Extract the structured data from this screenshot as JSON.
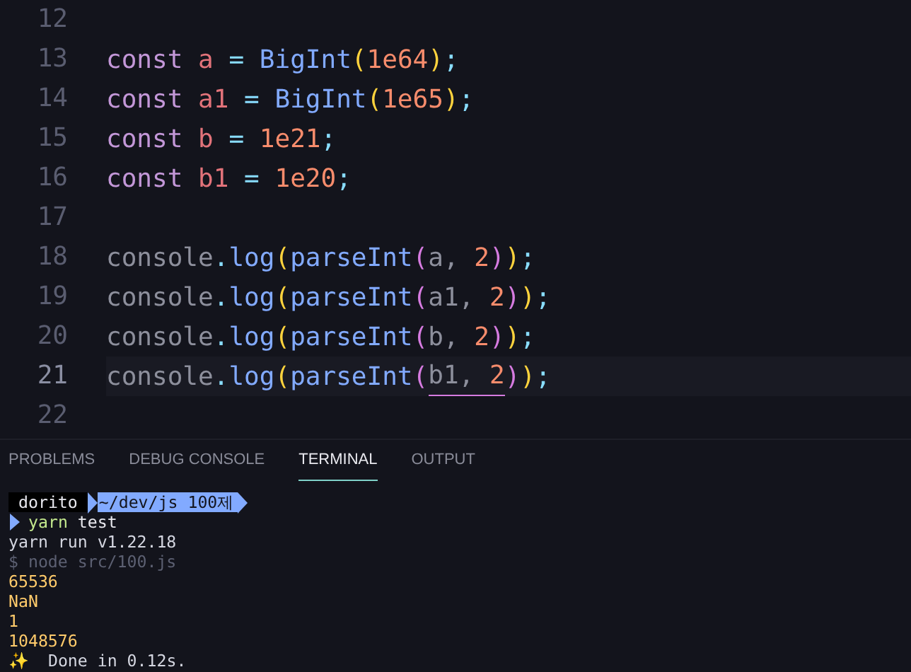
{
  "editor": {
    "lines": [
      {
        "number": "12",
        "current": false
      },
      {
        "number": "13",
        "current": false,
        "tokens": [
          {
            "kind": "keyword",
            "text": "const"
          },
          {
            "kind": "variable",
            "text": " a"
          },
          {
            "kind": "operator",
            "text": " ="
          },
          {
            "kind": "function",
            "text": " BigInt"
          },
          {
            "kind": "bracket1",
            "text": "("
          },
          {
            "kind": "number",
            "text": "1e64"
          },
          {
            "kind": "bracket1",
            "text": ")"
          },
          {
            "kind": "punct",
            "text": ";"
          }
        ]
      },
      {
        "number": "14",
        "current": false,
        "tokens": [
          {
            "kind": "keyword",
            "text": "const"
          },
          {
            "kind": "variable",
            "text": " a1"
          },
          {
            "kind": "operator",
            "text": " ="
          },
          {
            "kind": "function",
            "text": " BigInt"
          },
          {
            "kind": "bracket1",
            "text": "("
          },
          {
            "kind": "number",
            "text": "1e65"
          },
          {
            "kind": "bracket1",
            "text": ")"
          },
          {
            "kind": "punct",
            "text": ";"
          }
        ]
      },
      {
        "number": "15",
        "current": false,
        "tokens": [
          {
            "kind": "keyword",
            "text": "const"
          },
          {
            "kind": "variable",
            "text": " b"
          },
          {
            "kind": "operator",
            "text": " ="
          },
          {
            "kind": "number",
            "text": " 1e21"
          },
          {
            "kind": "punct",
            "text": ";"
          }
        ]
      },
      {
        "number": "16",
        "current": false,
        "tokens": [
          {
            "kind": "keyword",
            "text": "const"
          },
          {
            "kind": "variable",
            "text": " b1"
          },
          {
            "kind": "operator",
            "text": " ="
          },
          {
            "kind": "number",
            "text": " 1e20"
          },
          {
            "kind": "punct",
            "text": ";"
          }
        ]
      },
      {
        "number": "17",
        "current": false
      },
      {
        "number": "18",
        "current": false,
        "tokens": [
          {
            "kind": "object",
            "text": "console"
          },
          {
            "kind": "punct",
            "text": "."
          },
          {
            "kind": "function",
            "text": "log"
          },
          {
            "kind": "bracket1",
            "text": "("
          },
          {
            "kind": "function",
            "text": "parseInt"
          },
          {
            "kind": "bracket2",
            "text": "("
          },
          {
            "kind": "object",
            "text": "a,"
          },
          {
            "kind": "number",
            "text": " 2"
          },
          {
            "kind": "bracket2",
            "text": ")"
          },
          {
            "kind": "bracket1",
            "text": ")"
          },
          {
            "kind": "punct",
            "text": ";"
          }
        ]
      },
      {
        "number": "19",
        "current": false,
        "tokens": [
          {
            "kind": "object",
            "text": "console"
          },
          {
            "kind": "punct",
            "text": "."
          },
          {
            "kind": "function",
            "text": "log"
          },
          {
            "kind": "bracket1",
            "text": "("
          },
          {
            "kind": "function",
            "text": "parseInt"
          },
          {
            "kind": "bracket2",
            "text": "("
          },
          {
            "kind": "object",
            "text": "a1,"
          },
          {
            "kind": "number",
            "text": " 2"
          },
          {
            "kind": "bracket2",
            "text": ")"
          },
          {
            "kind": "bracket1",
            "text": ")"
          },
          {
            "kind": "punct",
            "text": ";"
          }
        ]
      },
      {
        "number": "20",
        "current": false,
        "tokens": [
          {
            "kind": "object",
            "text": "console"
          },
          {
            "kind": "punct",
            "text": "."
          },
          {
            "kind": "function",
            "text": "log"
          },
          {
            "kind": "bracket1",
            "text": "("
          },
          {
            "kind": "function",
            "text": "parseInt"
          },
          {
            "kind": "bracket2",
            "text": "("
          },
          {
            "kind": "object",
            "text": "b,"
          },
          {
            "kind": "number",
            "text": " 2"
          },
          {
            "kind": "bracket2",
            "text": ")"
          },
          {
            "kind": "bracket1",
            "text": ")"
          },
          {
            "kind": "punct",
            "text": ";"
          }
        ]
      },
      {
        "number": "21",
        "current": true,
        "tokens": [
          {
            "kind": "object",
            "text": "console"
          },
          {
            "kind": "punct",
            "text": "."
          },
          {
            "kind": "function",
            "text": "log"
          },
          {
            "kind": "bracket1",
            "text": "("
          },
          {
            "kind": "function",
            "text": "parseInt"
          },
          {
            "kind": "bracket2",
            "text": "("
          },
          {
            "kind": "object",
            "text": "b1,",
            "underlined": true
          },
          {
            "kind": "number",
            "text": " 2",
            "underlined": true
          },
          {
            "kind": "bracket2",
            "text": ")"
          },
          {
            "kind": "bracket1",
            "text": ")"
          },
          {
            "kind": "punct",
            "text": ";"
          }
        ]
      },
      {
        "number": "22",
        "current": false
      }
    ]
  },
  "panel": {
    "tabs": [
      {
        "label": "PROBLEMS",
        "selected": false
      },
      {
        "label": "DEBUG CONSOLE",
        "selected": false
      },
      {
        "label": "TERMINAL",
        "selected": true
      },
      {
        "label": "OUTPUT",
        "selected": false
      }
    ]
  },
  "terminal": {
    "prompt": {
      "user": "dorito",
      "path": "~/dev/js 100제"
    },
    "command": {
      "program": "yarn",
      "args": "test"
    },
    "lines": [
      {
        "kind": "normal",
        "text": "yarn run v1.22.18"
      },
      {
        "kind": "dim",
        "text": "$ node src/100.js"
      },
      {
        "kind": "output",
        "text": "65536"
      },
      {
        "kind": "output",
        "text": "NaN"
      },
      {
        "kind": "output",
        "text": "1"
      },
      {
        "kind": "output",
        "text": "1048576"
      },
      {
        "kind": "normal",
        "text": "✨  Done in 0.12s."
      }
    ]
  }
}
